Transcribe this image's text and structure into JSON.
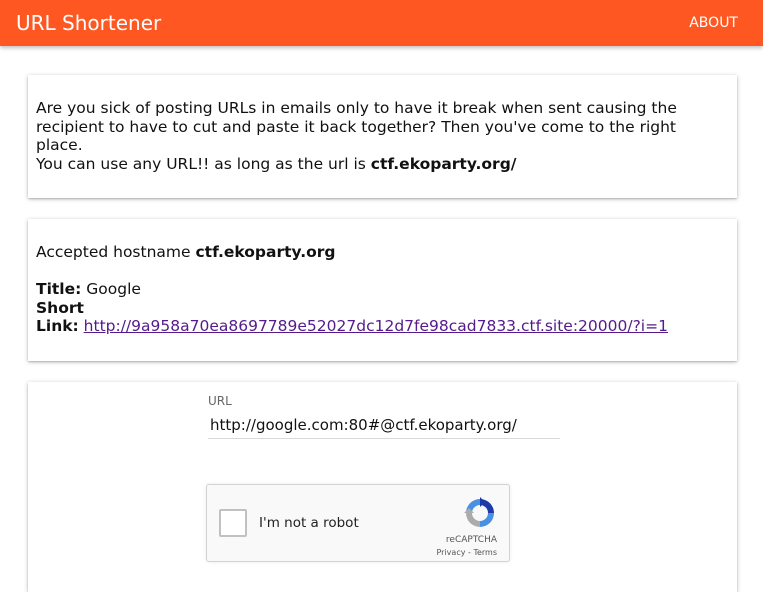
{
  "header": {
    "title": "URL Shortener",
    "about_label": "ABOUT"
  },
  "intro_card": {
    "line1": "Are you sick of posting URLs in emails only to have it break when sent causing the recipient to have to cut and paste it back together? Then you've come to the right place.",
    "line2_prefix": "You can use any URL!! as long as the url is ",
    "allowed_domain": "ctf.ekoparty.org/"
  },
  "result_card": {
    "hostname_label": "Accepted hostname ",
    "hostname_value": "ctf.ekoparty.org",
    "title_label": "Title:",
    "title_value": " Google",
    "short_label": "Short",
    "link_label": "Link:",
    "link_value": "http://9a958a70ea8697789e52027dc12d7fe98cad7833.ctf.site:20000/?i=1"
  },
  "form_card": {
    "url_label": "URL",
    "url_value": "http://google.com:80#@ctf.ekoparty.org/"
  },
  "recaptcha": {
    "checkbox_label": "I'm not a robot",
    "brand": "reCAPTCHA",
    "privacy": "Privacy",
    "separator": " - ",
    "terms": "Terms"
  }
}
